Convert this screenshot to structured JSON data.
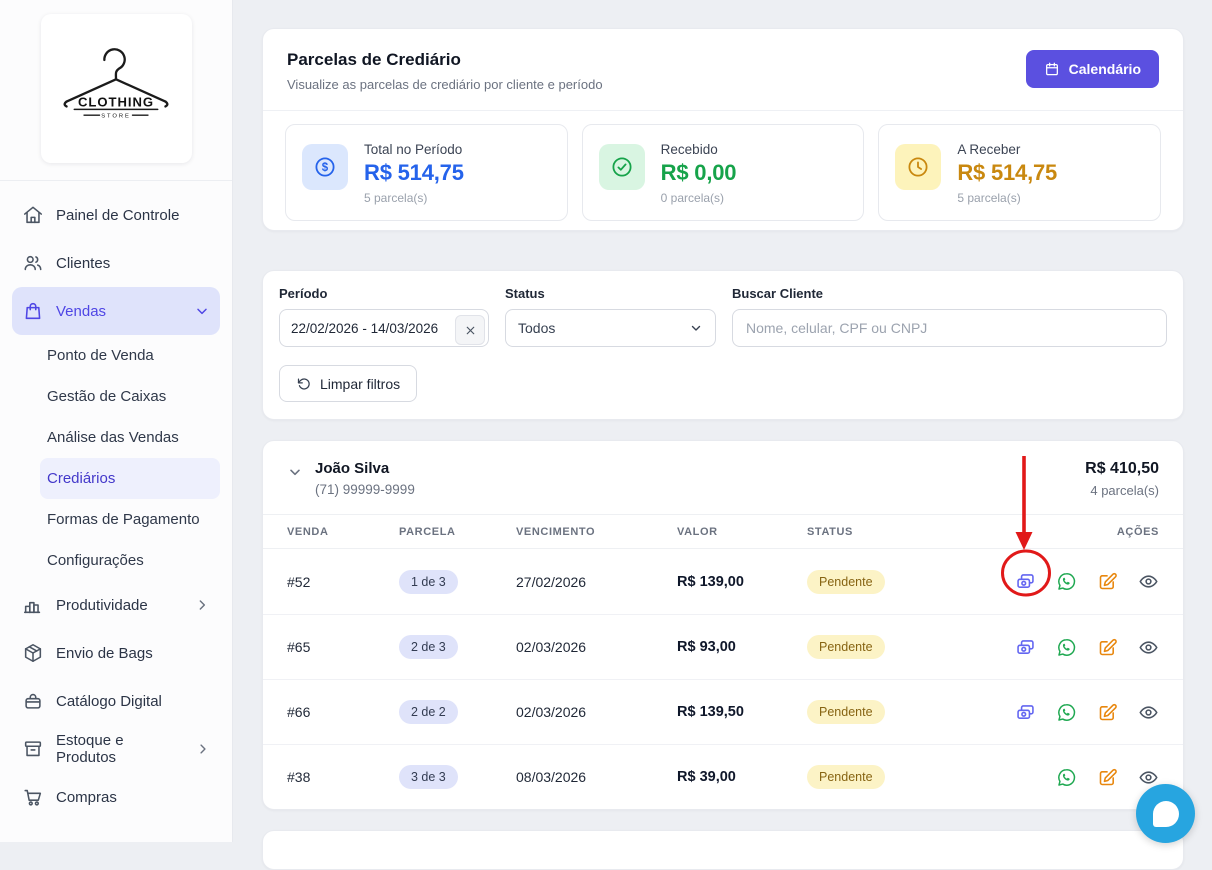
{
  "sidebar": {
    "logo": {
      "text": "CLOTHING",
      "subtext": "STORE"
    },
    "items": [
      {
        "label": "Painel de Controle",
        "icon": "home-icon"
      },
      {
        "label": "Clientes",
        "icon": "users-icon"
      },
      {
        "label": "Vendas",
        "icon": "shopping-bag-icon",
        "active": true,
        "expanded": true
      },
      {
        "label": "Produtividade",
        "icon": "bar-chart-icon",
        "has_submenu": true
      },
      {
        "label": "Envio de Bags",
        "icon": "package-icon"
      },
      {
        "label": "Catálogo Digital",
        "icon": "handbag-icon"
      },
      {
        "label": "Estoque e Produtos",
        "icon": "archive-icon",
        "has_submenu": true
      },
      {
        "label": "Compras",
        "icon": "cart-icon"
      }
    ],
    "vendas_submenu": {
      "items": [
        "Ponto de Venda",
        "Gestão de Caixas",
        "Análise das Vendas",
        "Crediários",
        "Formas de Pagamento",
        "Configurações"
      ],
      "active": "Crediários"
    }
  },
  "header": {
    "title": "Parcelas de Crediário",
    "subtitle": "Visualize as parcelas de crediário por cliente e período",
    "calendar_button": "Calendário"
  },
  "summary_cards": [
    {
      "label": "Total no Período",
      "value": "R$ 514,75",
      "count": "5 parcela(s)",
      "icon": "dollar-circle-icon",
      "color": "#2563eb",
      "bg": "#dbe7fd"
    },
    {
      "label": "Recebido",
      "value": "R$ 0,00",
      "count": "0 parcela(s)",
      "icon": "check-circle-icon",
      "color": "#16a34a",
      "bg": "#d9f5e2"
    },
    {
      "label": "A Receber",
      "value": "R$ 514,75",
      "count": "5 parcela(s)",
      "icon": "clock-icon",
      "color": "#c9880f",
      "bg": "#fdf3bb"
    }
  ],
  "filters": {
    "period_label": "Período",
    "period_value": "22/02/2026 - 14/03/2026",
    "status_label": "Status",
    "status_value": "Todos",
    "search_label": "Buscar Cliente",
    "search_placeholder": "Nome, celular, CPF ou CNPJ",
    "clear_button": "Limpar filtros"
  },
  "client_group": {
    "name": "João Silva",
    "phone": "(71) 99999-9999",
    "total": "R$ 410,50",
    "count": "4 parcela(s)"
  },
  "table": {
    "headers": [
      "VENDA",
      "PARCELA",
      "VENCIMENTO",
      "VALOR",
      "STATUS",
      "AÇÕES"
    ],
    "rows": [
      {
        "venda": "#52",
        "parcela": "1 de 3",
        "vencimento": "27/02/2026",
        "valor": "R$ 139,00",
        "status": "Pendente",
        "actions": [
          "receive-payment",
          "whatsapp",
          "edit",
          "view"
        ]
      },
      {
        "venda": "#65",
        "parcela": "2 de 3",
        "vencimento": "02/03/2026",
        "valor": "R$ 93,00",
        "status": "Pendente",
        "actions": [
          "receive-payment",
          "whatsapp",
          "edit",
          "view"
        ]
      },
      {
        "venda": "#66",
        "parcela": "2 de 2",
        "vencimento": "02/03/2026",
        "valor": "R$ 139,50",
        "status": "Pendente",
        "actions": [
          "receive-payment",
          "whatsapp",
          "edit",
          "view"
        ]
      },
      {
        "venda": "#38",
        "parcela": "3 de 3",
        "vencimento": "08/03/2026",
        "valor": "R$ 39,00",
        "status": "Pendente",
        "actions": [
          "whatsapp",
          "edit",
          "view"
        ]
      }
    ]
  },
  "annotation": {
    "shape": "red-arrow-and-ellipse",
    "target": "row-1 receive-payment icon",
    "color": "#e11919"
  },
  "colors": {
    "accent": "#5b50e0",
    "sidebar_active": "#4f46e5",
    "blue": "#2563eb",
    "green": "#16a34a",
    "amber": "#c9880f",
    "whatsapp": "#1fa851",
    "edit_orange": "#e8870e",
    "money_icon": "#6366f1",
    "chat_bubble": "#27a5e0",
    "annotation_red": "#e11919"
  },
  "icons_legend": {
    "calendar-icon": "calendar glyph",
    "dollar-circle-icon": "$ in circle",
    "check-circle-icon": "check in circle",
    "clock-icon": "clock",
    "x-icon": "×",
    "refresh-icon": "counterclockwise arrow",
    "banknotes-icon": "overlapping bills",
    "whatsapp-icon": "speech bubble phone",
    "pencil-square-icon": "edit pencil",
    "eye-icon": "eye",
    "chevron-down-icon": "⌄",
    "chevron-right-icon": "›"
  }
}
